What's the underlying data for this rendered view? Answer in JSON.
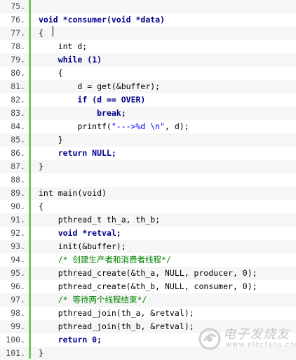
{
  "lines": [
    {
      "num": "75.",
      "code": ""
    },
    {
      "num": "76.",
      "code": "<span class=\"kw\">void</span> <span class=\"kw\">*consumer(void *data)</span>"
    },
    {
      "num": "77.",
      "code": "{"
    },
    {
      "num": "78.",
      "code": "    int d;"
    },
    {
      "num": "79.",
      "code": "    <span class=\"kw\">while</span> <span class=\"kw\">(1)</span>"
    },
    {
      "num": "80.",
      "code": "    {"
    },
    {
      "num": "81.",
      "code": "        d = get(&amp;buffer);"
    },
    {
      "num": "82.",
      "code": "        <span class=\"kw\">if</span> <span class=\"kw\">(d == OVER)</span>"
    },
    {
      "num": "83.",
      "code": "            <span class=\"kw\">break;</span>"
    },
    {
      "num": "84.",
      "code": "        printf(<span class=\"st\">\"---&gt;%d \\n\"</span>, d);"
    },
    {
      "num": "85.",
      "code": "    }"
    },
    {
      "num": "86.",
      "code": "    <span class=\"kw\">return NULL;</span>"
    },
    {
      "num": "87.",
      "code": "}"
    },
    {
      "num": "88.",
      "code": ""
    },
    {
      "num": "89.",
      "code": "int main(void)"
    },
    {
      "num": "90.",
      "code": "{"
    },
    {
      "num": "91.",
      "code": "    pthread_t th_a, th_b;"
    },
    {
      "num": "92.",
      "code": "    <span class=\"kw\">void *retval;</span>"
    },
    {
      "num": "93.",
      "code": "    init(&amp;buffer);"
    },
    {
      "num": "94.",
      "code": "    <span class=\"cm\">/* 创建生产者和消费者线程*/</span>"
    },
    {
      "num": "95.",
      "code": "    pthread_create(&amp;th_a, NULL, producer, 0);"
    },
    {
      "num": "96.",
      "code": "    pthread_create(&amp;th_b, NULL, consumer, 0);"
    },
    {
      "num": "97.",
      "code": "    <span class=\"cm\">/* 等待两个线程结束*/</span>"
    },
    {
      "num": "98.",
      "code": "    pthread_join(th_a, &amp;retval);"
    },
    {
      "num": "99.",
      "code": "    pthread_join(th_b, &amp;retval);"
    },
    {
      "num": "100.",
      "code": "    <span class=\"kw\">return 0;</span>"
    },
    {
      "num": "101.",
      "code": "}"
    }
  ],
  "watermark": {
    "text": "电子发烧友",
    "sub": "www.elecfans.com"
  },
  "colors": {
    "gutter_bar": "#6ccd5c",
    "keyword": "#00008b",
    "comment": "#008200",
    "string": "#0000ff"
  }
}
